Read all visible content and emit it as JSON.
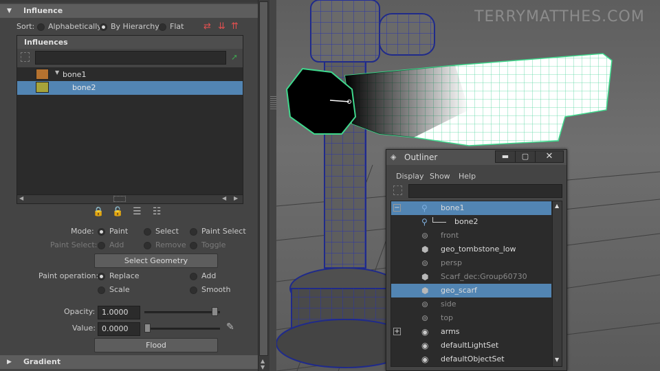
{
  "attribute_editor": {
    "section_title": "Influence",
    "sort": {
      "label": "Sort:",
      "options": [
        "Alphabetically",
        "By Hierarchy",
        "Flat"
      ],
      "selected": "By Hierarchy"
    },
    "influences_header": "Influences",
    "influences": [
      {
        "name": "bone1",
        "color": "#b5722f",
        "selected": false
      },
      {
        "name": "bone2",
        "color": "#a7a43a",
        "selected": true
      }
    ],
    "mode": {
      "label": "Mode:",
      "options": [
        "Paint",
        "Select",
        "Paint Select"
      ],
      "selected": "Paint"
    },
    "paint_select": {
      "label": "Paint Select:",
      "options": [
        "Add",
        "Remove",
        "Toggle"
      ]
    },
    "select_geometry_label": "Select Geometry",
    "paint_operation": {
      "label": "Paint operation:",
      "options": [
        "Replace",
        "Add",
        "Scale",
        "Smooth"
      ],
      "selected": "Replace"
    },
    "opacity": {
      "label": "Opacity:",
      "value": "1.0000",
      "fraction": 1.0
    },
    "value": {
      "label": "Value:",
      "value": "0.0000",
      "fraction": 0.0
    },
    "flood_label": "Flood",
    "gradient_title": "Gradient"
  },
  "viewport": {
    "watermark": "TERRYMATTHES.COM"
  },
  "outliner": {
    "title": "Outliner",
    "menu": [
      "Display",
      "Show",
      "Help"
    ],
    "items": [
      {
        "name": "bone1",
        "icon": "joint-icon",
        "selected": true,
        "dim": false,
        "expander": "minus"
      },
      {
        "name": "bone2",
        "icon": "joint-icon",
        "selected": false,
        "dim": false,
        "expander": ""
      },
      {
        "name": "front",
        "icon": "camera-icon",
        "selected": false,
        "dim": true,
        "expander": ""
      },
      {
        "name": "geo_tombstone_low",
        "icon": "mesh-icon",
        "selected": false,
        "dim": false,
        "expander": ""
      },
      {
        "name": "persp",
        "icon": "camera-icon",
        "selected": false,
        "dim": true,
        "expander": ""
      },
      {
        "name": "Scarf_dec:Group60730",
        "icon": "mesh-icon",
        "selected": false,
        "dim": true,
        "expander": ""
      },
      {
        "name": "geo_scarf",
        "icon": "mesh-icon",
        "selected": true,
        "dim": false,
        "expander": ""
      },
      {
        "name": "side",
        "icon": "camera-icon",
        "selected": false,
        "dim": true,
        "expander": ""
      },
      {
        "name": "top",
        "icon": "camera-icon",
        "selected": false,
        "dim": true,
        "expander": ""
      },
      {
        "name": "arms",
        "icon": "set-icon",
        "selected": false,
        "dim": false,
        "expander": "plus"
      },
      {
        "name": "defaultLightSet",
        "icon": "set-icon",
        "selected": false,
        "dim": false,
        "expander": ""
      },
      {
        "name": "defaultObjectSet",
        "icon": "set-icon",
        "selected": false,
        "dim": false,
        "expander": ""
      }
    ]
  }
}
